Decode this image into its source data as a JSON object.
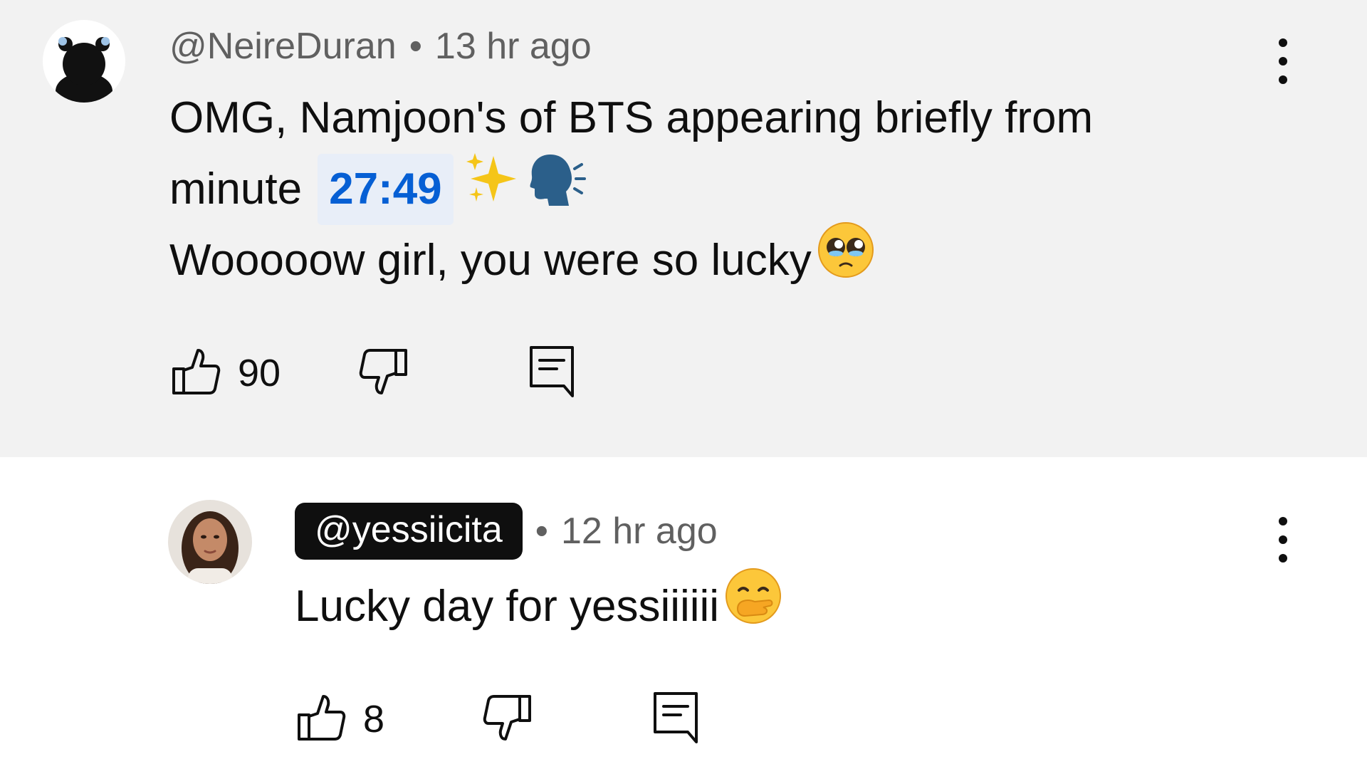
{
  "comments": [
    {
      "author": "@NeireDuran",
      "time": "13 hr ago",
      "line1": "OMG, Namjoon's of BTS appearing briefly from",
      "line2_prefix": "minute",
      "timestamp": "27:49",
      "line3": "Wooooow girl, you were so lucky",
      "emojis": [
        "sparkles-emoji",
        "speaking-head-emoji",
        "pleading-face-emoji"
      ],
      "likes": "90",
      "author_highlighted": false
    },
    {
      "author": "@yessiicita",
      "time": "12 hr ago",
      "text": "Lucky day for yessiiiiii",
      "emojis": [
        "face-with-hand-over-mouth-emoji"
      ],
      "likes": "8",
      "author_highlighted": true
    }
  ],
  "separator": "•",
  "icons": {
    "like": "thumb-up-icon",
    "dislike": "thumb-down-icon",
    "reply": "reply-icon",
    "menu": "more-vert-icon"
  },
  "colors": {
    "top_comment_bg": "#f2f2f2",
    "timestamp_link": "#065fd4",
    "author_pill_bg": "#0f0f0f",
    "meta_text": "#606060"
  }
}
